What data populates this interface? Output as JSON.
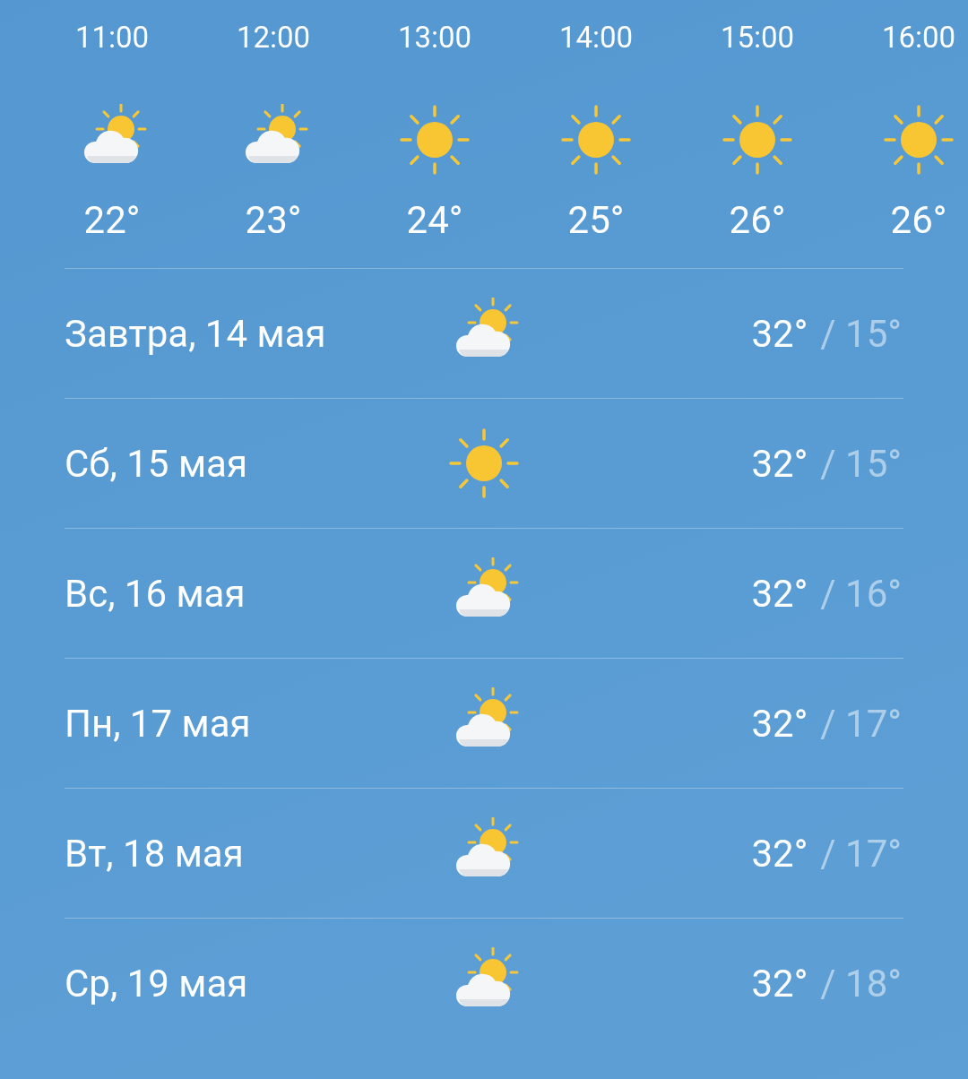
{
  "hourly": [
    {
      "time": "11:00",
      "kind": "partlycloudy",
      "temp": "22°"
    },
    {
      "time": "12:00",
      "kind": "partlycloudy",
      "temp": "23°"
    },
    {
      "time": "13:00",
      "kind": "sunny",
      "temp": "24°"
    },
    {
      "time": "14:00",
      "kind": "sunny",
      "temp": "25°"
    },
    {
      "time": "15:00",
      "kind": "sunny",
      "temp": "26°"
    },
    {
      "time": "16:00",
      "kind": "sunny",
      "temp": "26°"
    }
  ],
  "daily": [
    {
      "day": "Завтра, 14 мая",
      "kind": "partlycloudy",
      "high": "32°",
      "low": "/ 15°"
    },
    {
      "day": "Сб, 15 мая",
      "kind": "sunny",
      "high": "32°",
      "low": "/ 15°"
    },
    {
      "day": "Вс, 16 мая",
      "kind": "partlycloudy",
      "high": "32°",
      "low": "/ 16°"
    },
    {
      "day": "Пн, 17 мая",
      "kind": "partlycloudy",
      "high": "32°",
      "low": "/ 17°"
    },
    {
      "day": "Вт, 18 мая",
      "kind": "partlycloudy",
      "high": "32°",
      "low": "/ 17°"
    },
    {
      "day": "Ср, 19 мая",
      "kind": "partlycloudy",
      "high": "32°",
      "low": "/ 18°"
    }
  ]
}
